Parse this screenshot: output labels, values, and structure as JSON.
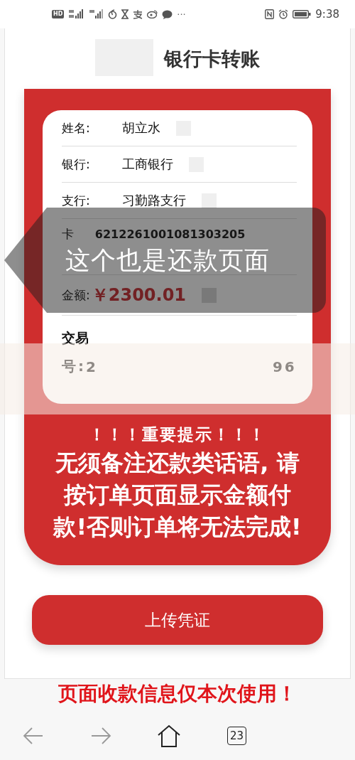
{
  "status_bar": {
    "hd_label": "HD",
    "left_text": "···",
    "time": "9:38"
  },
  "header": {
    "title": "银行卡转账"
  },
  "details": [
    {
      "kind": "text",
      "label": "姓名:",
      "value": "胡立水"
    },
    {
      "kind": "text",
      "label": "银行:",
      "value": "工商银行"
    },
    {
      "kind": "text",
      "label": "支行:",
      "value": "习勤路支行"
    },
    {
      "kind": "card",
      "label": "卡",
      "value": "6212261001081303205"
    },
    {
      "kind": "amount",
      "label": "金额:",
      "value": "￥2300.01"
    }
  ],
  "transaction": {
    "label_line1": "交易",
    "label_line2": "号:",
    "value_start": "2",
    "value_end": "96"
  },
  "notice": {
    "heading": "！！！重要提示！！！",
    "body_lines": [
      "无须备注还款类话语, 请",
      "按订单页面显示金额付",
      "款!否则订单将无法完成!"
    ]
  },
  "upload_button": "上传凭证",
  "footer_notice": "页面收款信息仅本次使用！",
  "browser_nav": {
    "tab_count": "23"
  },
  "annotation": {
    "text": "这个也是还款页面"
  }
}
